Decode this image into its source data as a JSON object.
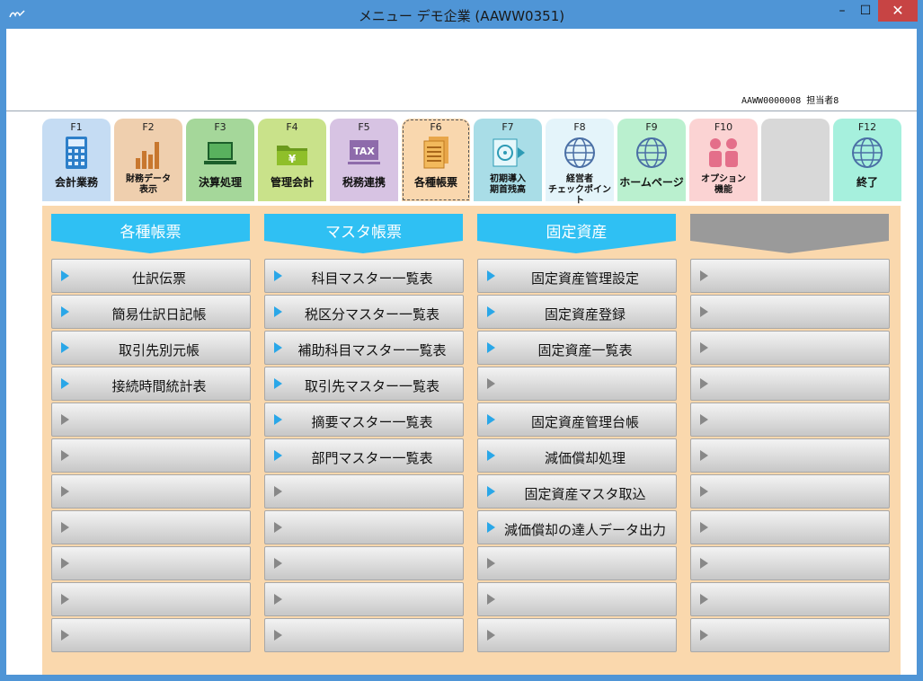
{
  "window": {
    "title": "メニュー デモ企業 (AAWW0351)",
    "min": "–",
    "max": "☐",
    "close": "✕"
  },
  "header": {
    "user_info": "AAWW0000008 担当者8"
  },
  "fkeys": [
    {
      "key": "F1",
      "label": "会計業務",
      "color": "#c5dcf3",
      "icon": "calculator-icon"
    },
    {
      "key": "F2",
      "label": "財務データ 表示",
      "color": "#efcfae",
      "icon": "bar-chart-icon"
    },
    {
      "key": "F3",
      "label": "決算処理",
      "color": "#a5d79a",
      "icon": "laptop-icon"
    },
    {
      "key": "F4",
      "label": "管理会計",
      "color": "#c9e28a",
      "icon": "yen-folder-icon"
    },
    {
      "key": "F5",
      "label": "税務連携",
      "color": "#d7c3e3",
      "icon": "tax-icon"
    },
    {
      "key": "F6",
      "label": "各種帳票",
      "color": "#f9d7ae",
      "icon": "documents-icon"
    },
    {
      "key": "F7",
      "label": "初期導入 期首残高",
      "color": "#a9dde7",
      "icon": "disc-icon"
    },
    {
      "key": "F8",
      "label": "経営者 チェックポイント",
      "color": "#e4f4fa",
      "icon": "globe-icon"
    },
    {
      "key": "F9",
      "label": "ホームページ",
      "color": "#baf0cf",
      "icon": "globe-icon"
    },
    {
      "key": "F10",
      "label": "オプション 機能",
      "color": "#fbd3d3",
      "icon": "people-icon"
    },
    {
      "key": "",
      "label": "",
      "color": "#d8d8d8",
      "icon": ""
    },
    {
      "key": "F12",
      "label": "終了",
      "color": "#a6f0dd",
      "icon": "globe-icon"
    }
  ],
  "columns": [
    {
      "title": "各種帳票",
      "color": "#2fc0f3",
      "items": [
        "仕訳伝票",
        "簡易仕訳日記帳",
        "取引先別元帳",
        "接続時間統計表",
        "",
        "",
        "",
        "",
        "",
        "",
        ""
      ]
    },
    {
      "title": "マスタ帳票",
      "color": "#2fc0f3",
      "items": [
        "科目マスター一覧表",
        "税区分マスター一覧表",
        "補助科目マスター一覧表",
        "取引先マスター一覧表",
        "摘要マスター一覧表",
        "部門マスター一覧表",
        "",
        "",
        "",
        "",
        ""
      ]
    },
    {
      "title": "固定資産",
      "color": "#2fc0f3",
      "items": [
        "固定資産管理設定",
        "固定資産登録",
        "固定資産一覧表",
        "",
        "固定資産管理台帳",
        "減価償却処理",
        "固定資産マスタ取込",
        "減価償却の達人データ出力",
        "",
        "",
        ""
      ]
    },
    {
      "title": "",
      "color": "#9a9a9a",
      "items": [
        "",
        "",
        "",
        "",
        "",
        "",
        "",
        "",
        "",
        "",
        ""
      ]
    }
  ]
}
